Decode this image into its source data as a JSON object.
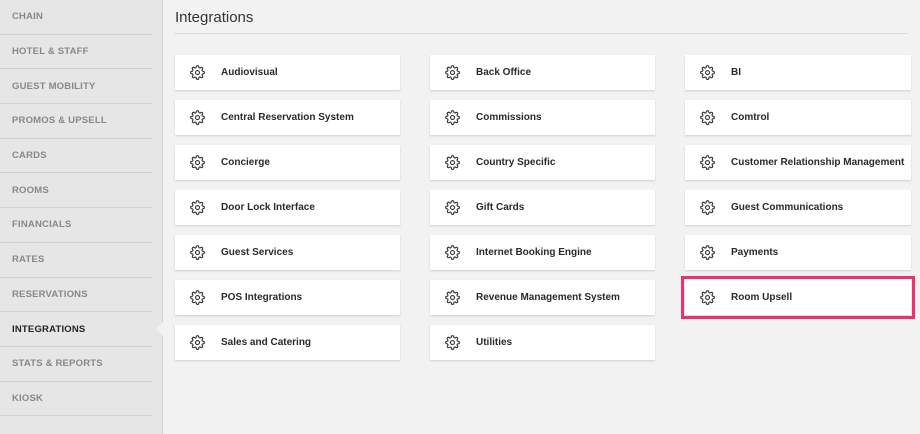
{
  "sidebar": {
    "items": [
      {
        "label": "CHAIN",
        "active": false
      },
      {
        "label": "HOTEL & STAFF",
        "active": false
      },
      {
        "label": "GUEST MOBILITY",
        "active": false
      },
      {
        "label": "PROMOS & UPSELL",
        "active": false
      },
      {
        "label": "CARDS",
        "active": false
      },
      {
        "label": "ROOMS",
        "active": false
      },
      {
        "label": "FINANCIALS",
        "active": false
      },
      {
        "label": "RATES",
        "active": false
      },
      {
        "label": "RESERVATIONS",
        "active": false
      },
      {
        "label": "INTEGRATIONS",
        "active": true
      },
      {
        "label": "STATS & REPORTS",
        "active": false
      },
      {
        "label": "KIOSK",
        "active": false
      }
    ]
  },
  "main": {
    "title": "Integrations",
    "cards": [
      {
        "label": "Audiovisual",
        "icon": "gear-icon"
      },
      {
        "label": "Back Office",
        "icon": "gear-icon"
      },
      {
        "label": "BI",
        "icon": "gear-icon"
      },
      {
        "label": "Central Reservation System",
        "icon": "gear-icon"
      },
      {
        "label": "Commissions",
        "icon": "gear-icon"
      },
      {
        "label": "Comtrol",
        "icon": "gear-icon"
      },
      {
        "label": "Concierge",
        "icon": "gear-icon"
      },
      {
        "label": "Country Specific",
        "icon": "gear-icon"
      },
      {
        "label": "Customer Relationship Management",
        "icon": "gear-icon"
      },
      {
        "label": "Door Lock Interface",
        "icon": "gear-icon"
      },
      {
        "label": "Gift Cards",
        "icon": "gear-icon"
      },
      {
        "label": "Guest Communications",
        "icon": "gear-icon"
      },
      {
        "label": "Guest Services",
        "icon": "gear-icon"
      },
      {
        "label": "Internet Booking Engine",
        "icon": "gear-icon"
      },
      {
        "label": "Payments",
        "icon": "gear-icon"
      },
      {
        "label": "POS Integrations",
        "icon": "gear-icon"
      },
      {
        "label": "Revenue Management System",
        "icon": "gear-icon"
      },
      {
        "label": "Room Upsell",
        "icon": "gear-icon",
        "highlighted": true
      },
      {
        "label": "Sales and Catering",
        "icon": "gear-icon"
      },
      {
        "label": "Utilities",
        "icon": "gear-icon"
      }
    ]
  },
  "colors": {
    "highlight": "#f0306a",
    "sidebar_bg": "#e6e6e6",
    "page_bg": "#f2f2f2"
  }
}
